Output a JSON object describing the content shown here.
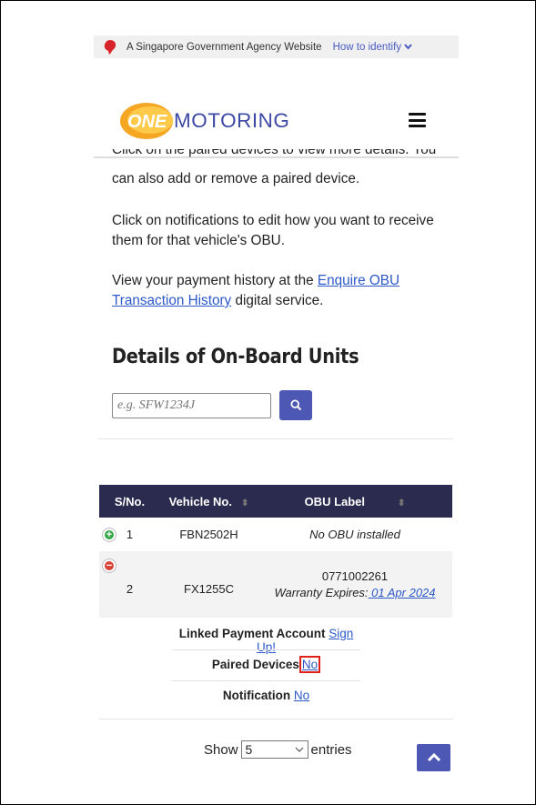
{
  "gov_banner": {
    "agency_text": "A Singapore Government Agency Website",
    "identify_link": "How to identify"
  },
  "header": {
    "logo_one": "ONE",
    "logo_motoring": "MOTORING"
  },
  "intro": {
    "clipped_line": "Click on the paired devices to view more details. You",
    "paragraph1_rest": "can also add or remove a paired device.",
    "paragraph2": "Click on notifications to edit how you want to receive them for that vehicle's OBU.",
    "paragraph3_prefix": "View your payment history at the ",
    "paragraph3_link": "Enquire OBU Transaction History",
    "paragraph3_suffix": " digital service."
  },
  "section_title": "Details of On-Board Units",
  "search": {
    "placeholder": "e.g. SFW1234J"
  },
  "table": {
    "headers": [
      "S/No.",
      "Vehicle No.",
      "OBU Label"
    ],
    "rows": [
      {
        "sno": "1",
        "vehicle": "FBN2502H",
        "obu": "No OBU installed"
      },
      {
        "sno": "2",
        "vehicle": "FX1255C",
        "obu_label": "0771002261",
        "warranty_prefix": "Warranty Expires:",
        "warranty_date": " 01 Apr 2024"
      }
    ]
  },
  "details": {
    "linked_payment_label": "Linked Payment Account",
    "linked_payment_value": "Sign Up!",
    "paired_devices_label": "Paired Devices",
    "paired_devices_value": "No",
    "notification_label": "Notification",
    "notification_value": "No"
  },
  "pagination": {
    "show_label": "Show",
    "entries_value": "5",
    "entries_label": "entries"
  },
  "colors": {
    "brand_blue": "#4d57b4",
    "header_dark": "#2a2b4f",
    "link": "#2c58c8",
    "highlight": "#e0201b",
    "logo_orange": "#f5a623"
  }
}
